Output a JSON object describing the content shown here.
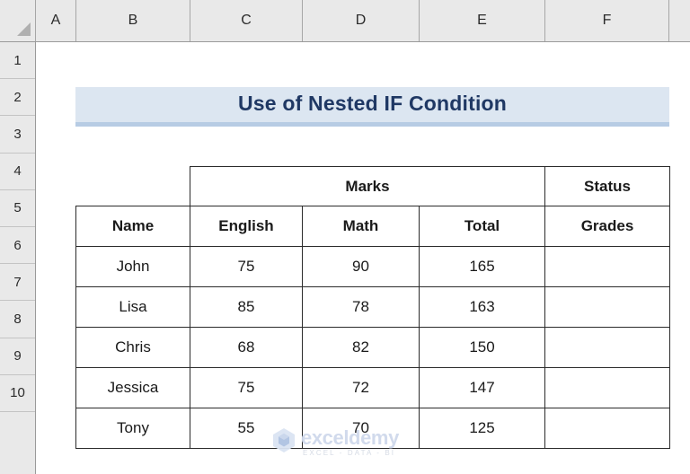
{
  "grid": {
    "column_headers": [
      "A",
      "B",
      "C",
      "D",
      "E",
      "F"
    ],
    "row_headers": [
      "1",
      "2",
      "3",
      "4",
      "5",
      "6",
      "7",
      "8",
      "9",
      "10"
    ],
    "select_all_label": ""
  },
  "banner": {
    "title": "Use of Nested IF Condition",
    "fill_color": "#dce6f1",
    "accent_color": "#b7cce4",
    "text_color": "#1f3864"
  },
  "table": {
    "group_headers": {
      "marks": "Marks",
      "status": "Status",
      "marks_fill": "#fce4d6",
      "status_fill": "#d9d9d9"
    },
    "columns": [
      "Name",
      "English",
      "Math",
      "Total",
      "Grades"
    ],
    "columns_fill": "#e2efda",
    "rows": [
      {
        "name": "John",
        "english": "75",
        "math": "90",
        "total": "165",
        "grades": ""
      },
      {
        "name": "Lisa",
        "english": "85",
        "math": "78",
        "total": "163",
        "grades": ""
      },
      {
        "name": "Chris",
        "english": "68",
        "math": "82",
        "total": "150",
        "grades": ""
      },
      {
        "name": "Jessica",
        "english": "75",
        "math": "72",
        "total": "147",
        "grades": ""
      },
      {
        "name": "Tony",
        "english": "55",
        "math": "70",
        "total": "125",
        "grades": ""
      }
    ]
  },
  "watermark": {
    "name": "exceldemy",
    "tagline": "EXCEL - DATA - BI",
    "color": "#cfd9ec"
  }
}
